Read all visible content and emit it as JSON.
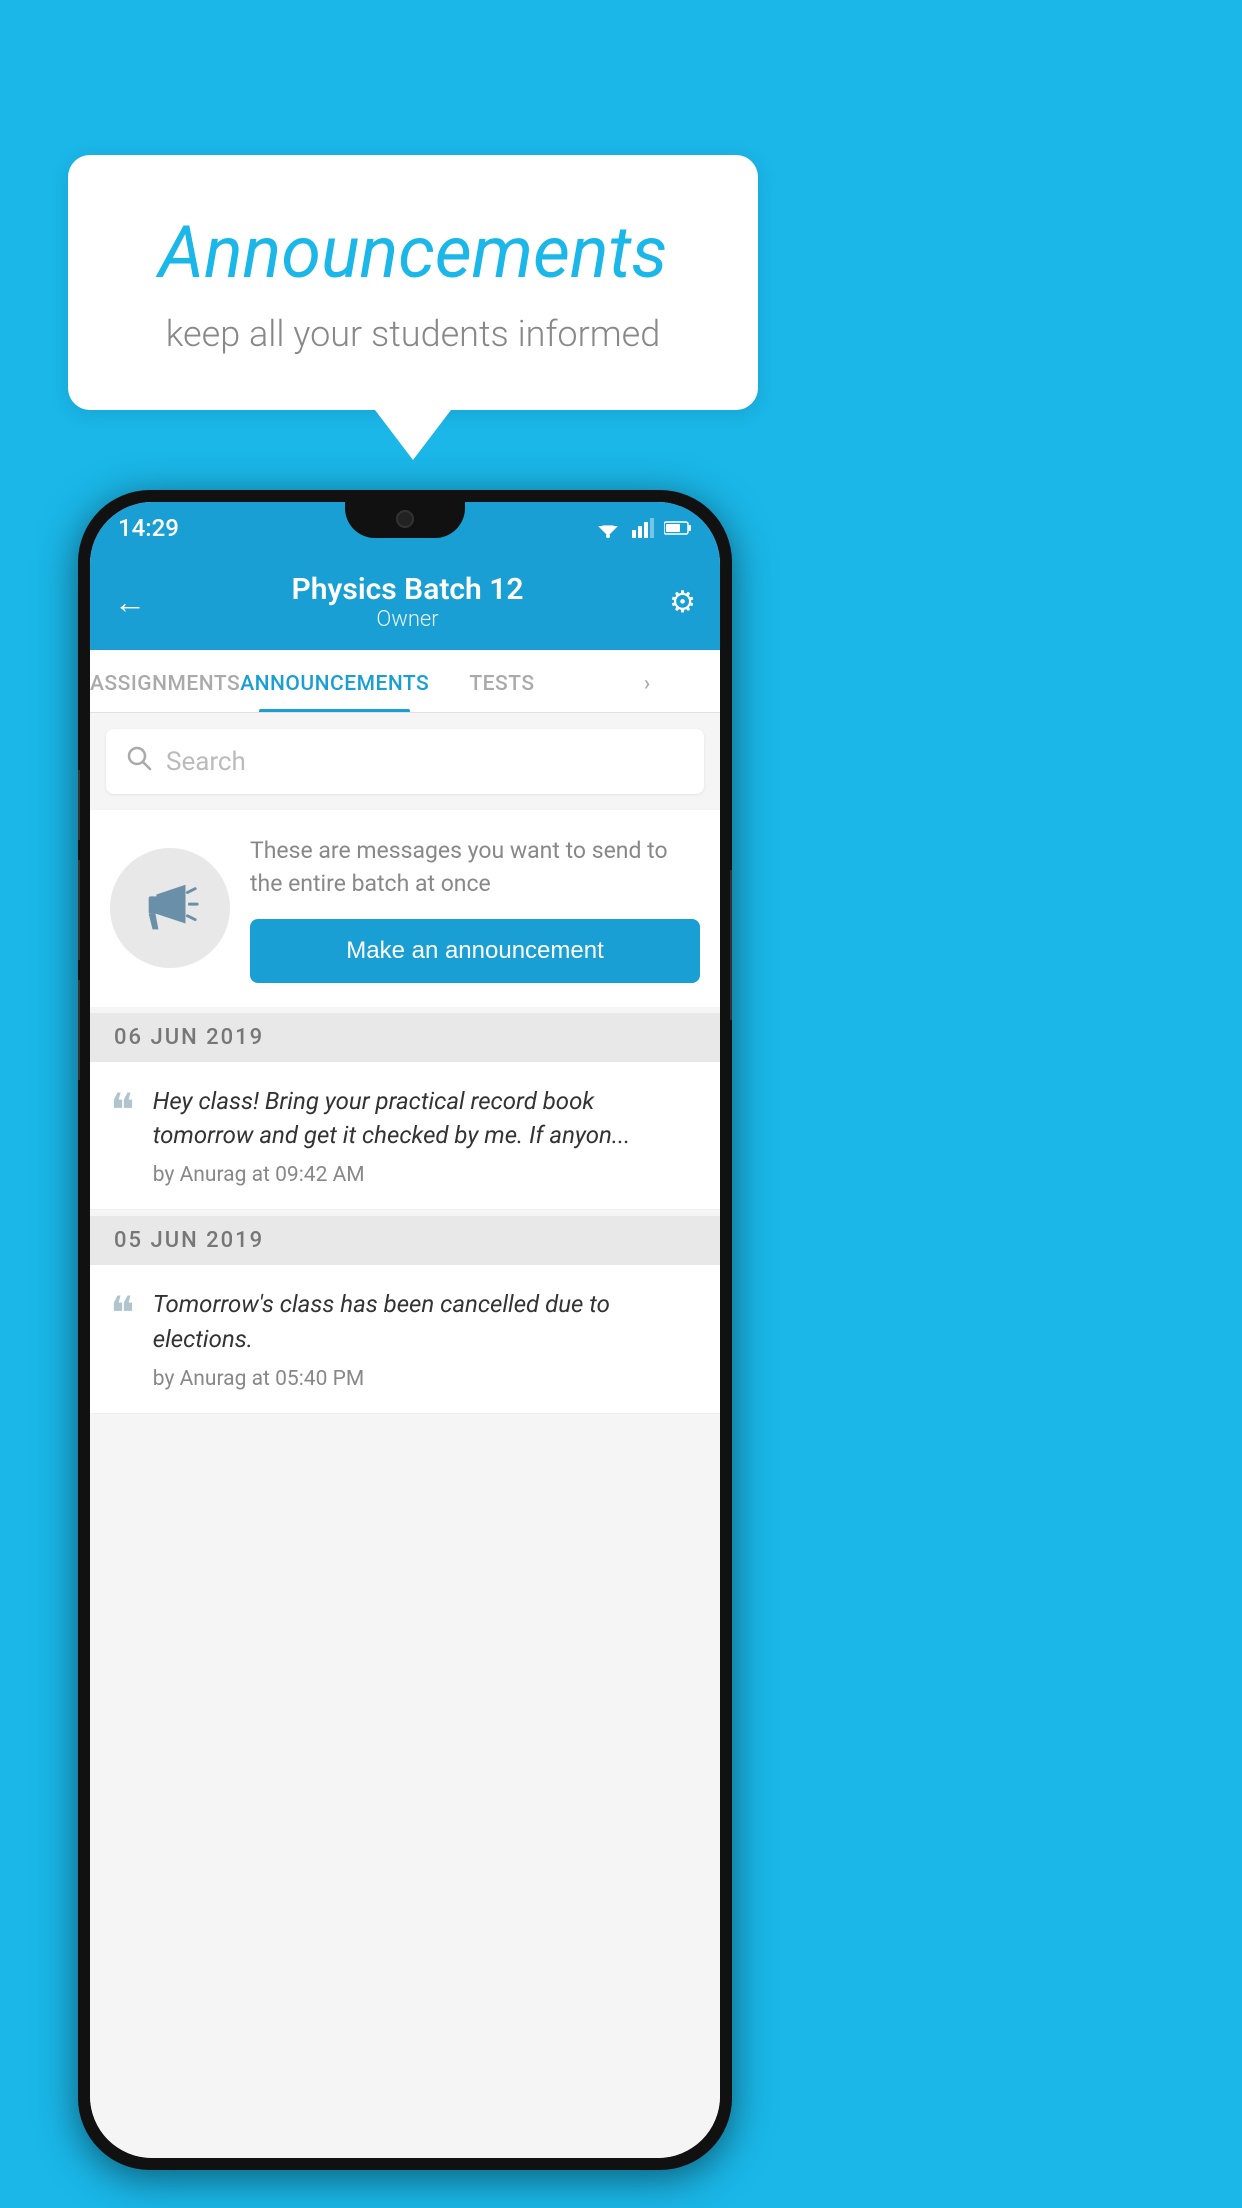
{
  "background_color": "#1ab7e8",
  "speech_bubble": {
    "title": "Announcements",
    "subtitle": "keep all your students informed"
  },
  "status_bar": {
    "time": "14:29"
  },
  "header": {
    "title": "Physics Batch 12",
    "subtitle": "Owner",
    "back_label": "←",
    "gear_label": "⚙"
  },
  "tabs": [
    {
      "label": "ASSIGNMENTS",
      "active": false
    },
    {
      "label": "ANNOUNCEMENTS",
      "active": true
    },
    {
      "label": "TESTS",
      "active": false
    },
    {
      "label": "›",
      "active": false
    }
  ],
  "search": {
    "placeholder": "Search"
  },
  "empty_state": {
    "description": "These are messages you want to send to the entire batch at once",
    "button_label": "Make an announcement"
  },
  "announcement_groups": [
    {
      "date": "06  JUN  2019",
      "items": [
        {
          "message": "Hey class! Bring your practical record book tomorrow and get it checked by me. If anyon...",
          "meta": "by Anurag at 09:42 AM"
        }
      ]
    },
    {
      "date": "05  JUN  2019",
      "items": [
        {
          "message": "Tomorrow's class has been cancelled due to elections.",
          "meta": "by Anurag at 05:40 PM"
        }
      ]
    }
  ]
}
